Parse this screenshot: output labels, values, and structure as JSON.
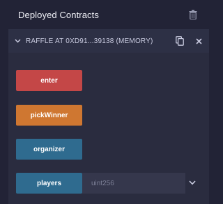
{
  "header": {
    "title": "Deployed Contracts",
    "trash_icon": "trash-icon"
  },
  "contract": {
    "name": "RAFFLE AT 0XD91...39138 (MEMORY)",
    "collapse_icon": "chevron-down-icon",
    "copy_icon": "copy-icon",
    "close_icon": "close-icon"
  },
  "functions": [
    {
      "label": "enter",
      "color": "#c44747"
    },
    {
      "label": "pickWinner",
      "color": "#cf7731"
    },
    {
      "label": "organizer",
      "color": "#2f6b8f"
    },
    {
      "label": "players",
      "color": "#2f6b8f",
      "input_placeholder": "uint256",
      "expand_icon": "chevron-down-icon"
    }
  ],
  "colors": {
    "background": "#222336",
    "panel": "#2a2c3f",
    "input": "#35374c"
  }
}
